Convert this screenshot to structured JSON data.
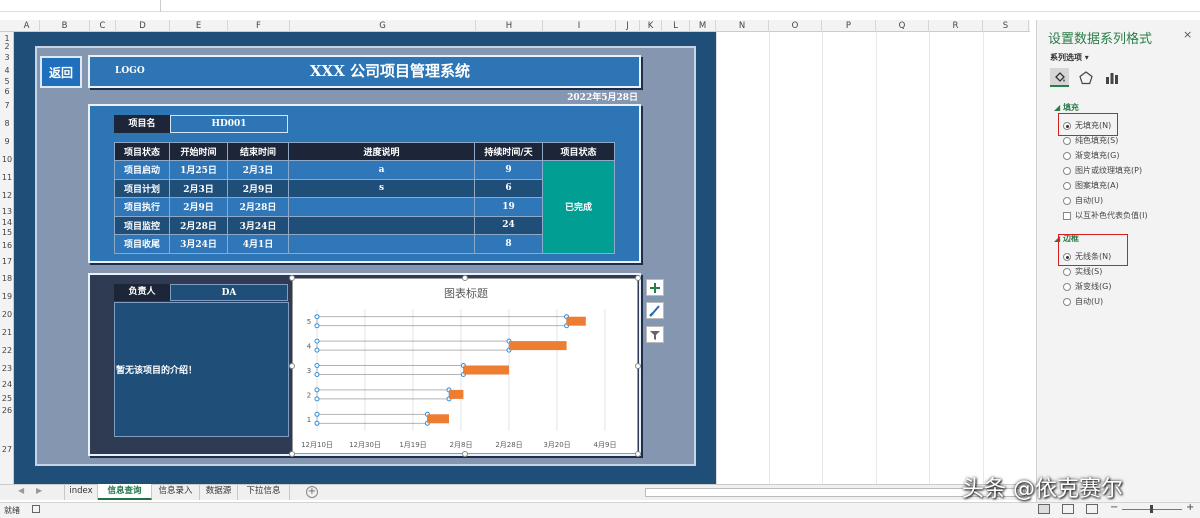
{
  "columns": [
    "A",
    "B",
    "C",
    "D",
    "E",
    "F",
    "G",
    "H",
    "I",
    "J",
    "K",
    "L",
    "M",
    "N",
    "O",
    "P",
    "Q",
    "R",
    "S"
  ],
  "rows": [
    "1",
    "2",
    "3",
    "4",
    "5",
    "6",
    "7",
    "8",
    "9",
    "10",
    "11",
    "12",
    "13",
    "14",
    "15",
    "16",
    "17",
    "18",
    "19",
    "20",
    "21",
    "22",
    "23",
    "24",
    "25",
    "26",
    "27"
  ],
  "dashboard": {
    "back_label": "返回",
    "logo": "LOGO",
    "title": "XXX 公司项目管理系统",
    "date": "2022年5月28日",
    "project_name_label": "项目名",
    "project_name_value": "HD001",
    "table_headers": [
      "项目状态",
      "开始时间",
      "结束时间",
      "进度说明",
      "持续时间/天",
      "项目状态"
    ],
    "table_rows": [
      {
        "stage": "项目启动",
        "start": "1月25日",
        "end": "2月3日",
        "note": "a",
        "days": "9"
      },
      {
        "stage": "项目计划",
        "start": "2月3日",
        "end": "2月9日",
        "note": "s",
        "days": "6"
      },
      {
        "stage": "项目执行",
        "start": "2月9日",
        "end": "2月28日",
        "note": "",
        "days": "19"
      },
      {
        "stage": "项目监控",
        "start": "2月28日",
        "end": "3月24日",
        "note": "",
        "days": "24"
      },
      {
        "stage": "项目收尾",
        "start": "3月24日",
        "end": "4月1日",
        "note": "",
        "days": "8"
      }
    ],
    "overall_status": "已完成",
    "manager_label": "负责人",
    "manager_value": "DA",
    "intro_text": "暂无该项目的介绍！"
  },
  "chart_data": {
    "type": "bar",
    "orientation": "horizontal-stacked",
    "title": "图表标题",
    "categories": [
      "1",
      "2",
      "3",
      "4",
      "5"
    ],
    "x_tick_labels": [
      "12月10日",
      "12月30日",
      "1月19日",
      "2月8日",
      "2月28日",
      "3月20日",
      "4月9日"
    ],
    "xlim": [
      "2021-12-10",
      "2022-04-19"
    ],
    "series": [
      {
        "values": [
          "2022-01-25",
          "2022-02-03",
          "2022-02-09",
          "2022-02-28",
          "2022-03-24"
        ],
        "fill": "none",
        "selected": true
      },
      {
        "values": [
          9,
          6,
          19,
          24,
          8
        ],
        "color": "#ed7d31"
      }
    ]
  },
  "chart_tools": {
    "add_icon": "plus-icon",
    "style_icon": "brush-icon",
    "filter_icon": "filter-icon"
  },
  "format_pane": {
    "title": "设置数据系列格式",
    "close": "×",
    "series_options": "系列选项 ▾",
    "fill_section": "◢ 填充",
    "fill_options": [
      {
        "label": "无填充(N)",
        "selected": true
      },
      {
        "label": "纯色填充(S)",
        "selected": false
      },
      {
        "label": "渐变填充(G)",
        "selected": false
      },
      {
        "label": "图片或纹理填充(P)",
        "selected": false
      },
      {
        "label": "图案填充(A)",
        "selected": false
      },
      {
        "label": "自动(U)",
        "selected": false
      }
    ],
    "invert_label": "以互补色代表负值(I)",
    "border_section": "◢ 边框",
    "border_options": [
      {
        "label": "无线条(N)",
        "selected": true
      },
      {
        "label": "实线(S)",
        "selected": false
      },
      {
        "label": "渐变线(G)",
        "selected": false
      },
      {
        "label": "自动(U)",
        "selected": false
      }
    ]
  },
  "sheet_tabs": [
    "index",
    "信息查询",
    "信息录入",
    "数据源",
    "下拉信息"
  ],
  "active_tab": "信息查询",
  "status": {
    "ready": "就绪"
  },
  "watermark": "头条 @依克赛尔"
}
